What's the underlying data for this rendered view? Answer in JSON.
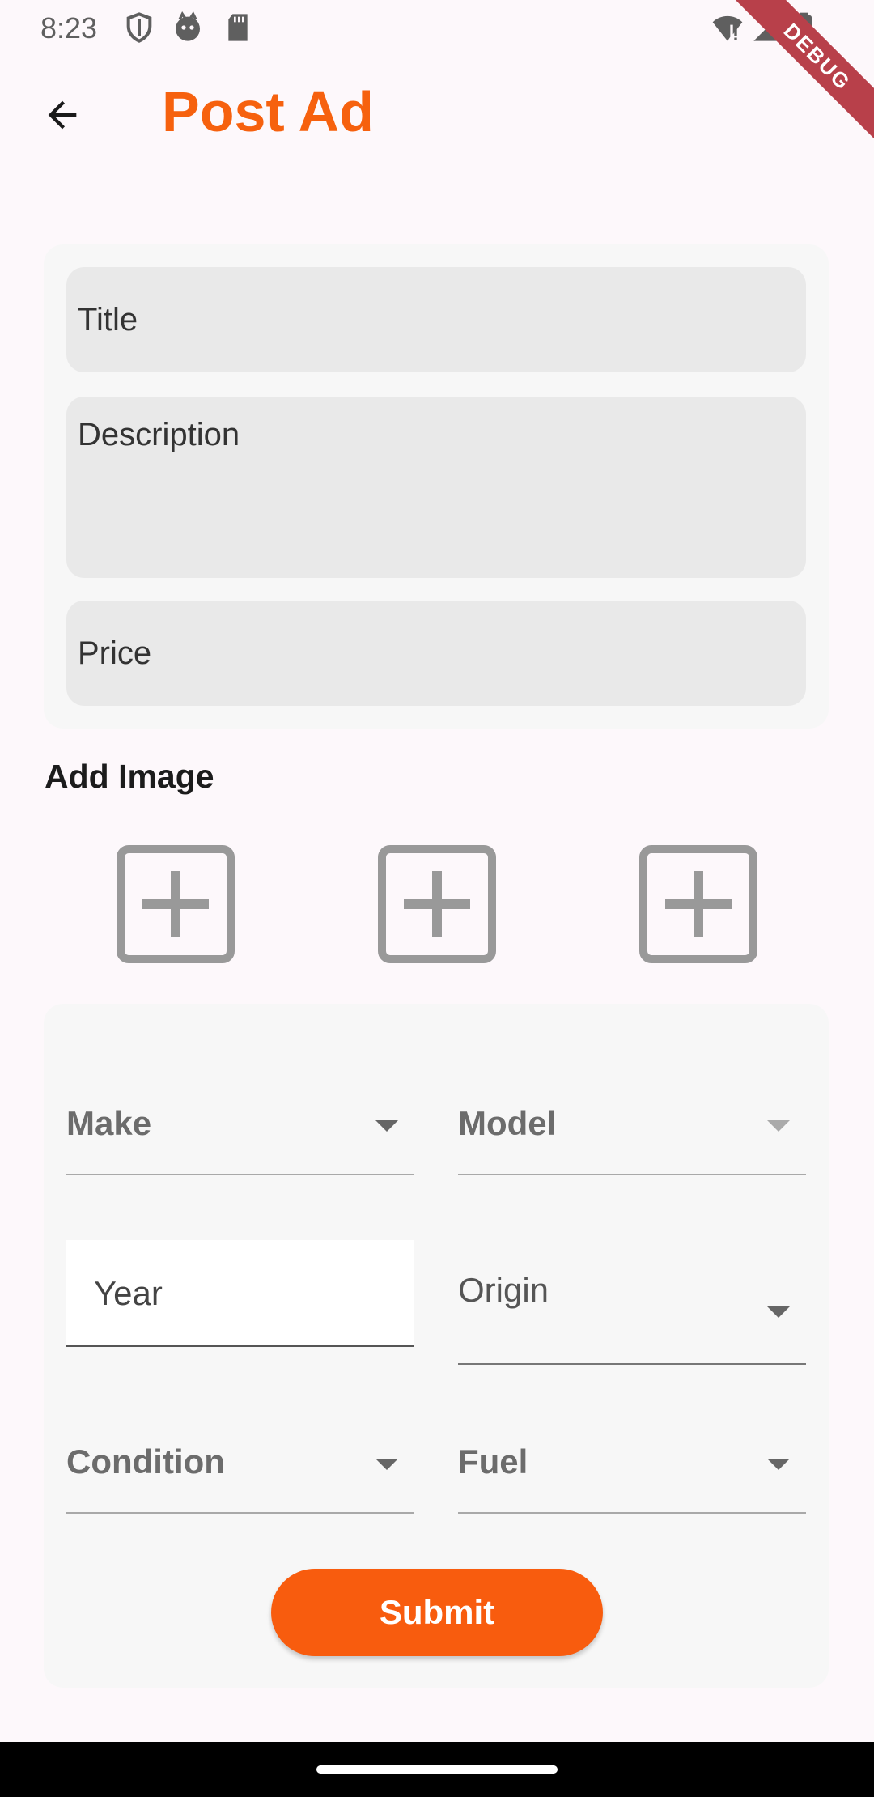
{
  "status_bar": {
    "time": "8:23",
    "icons": [
      "shield-icon",
      "face-icon",
      "sd-card-icon",
      "wifi-alert-icon",
      "signal-icon",
      "battery-icon"
    ],
    "debug_label": "DEBUG"
  },
  "app_bar": {
    "title": "Post Ad",
    "back_icon": "arrow-back-icon"
  },
  "form": {
    "title_placeholder": "Title",
    "description_placeholder": "Description",
    "price_placeholder": "Price"
  },
  "images": {
    "label": "Add Image",
    "slots": [
      "add-box-icon",
      "add-box-icon",
      "add-box-icon"
    ]
  },
  "details": {
    "make": "Make",
    "model": "Model",
    "year": "Year",
    "origin": "Origin",
    "condition": "Condition",
    "fuel": "Fuel"
  },
  "submit_label": "Submit",
  "colors": {
    "accent": "#f6610e",
    "button": "#f85c0e",
    "background": "#fdf8fb",
    "card": "#f7f7f7",
    "field": "#e9e9e9"
  }
}
